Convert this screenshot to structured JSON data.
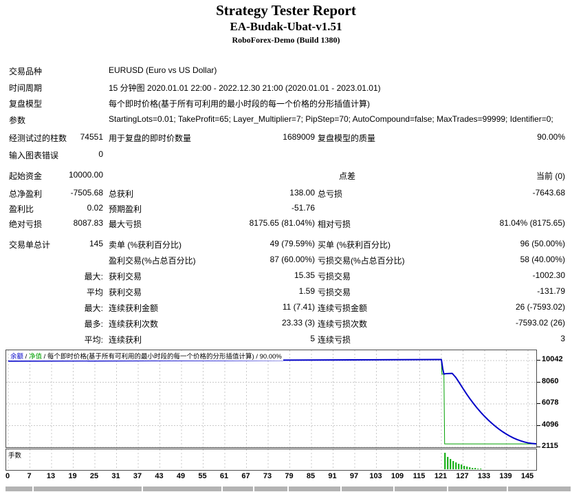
{
  "header": {
    "title": "Strategy Tester Report",
    "ea_name": "EA-Budak-Ubat-v1.51",
    "server": "RoboForex-Demo (Build 1380)"
  },
  "report": {
    "rows": [
      {
        "l1": "交易品种",
        "wide": "EURUSD (Euro vs US Dollar)"
      },
      {
        "l1": "时间周期",
        "wide": "15 分钟图 2020.01.01 22:00 - 2022.12.30 21:00 (2020.01.01 - 2023.01.01)"
      },
      {
        "l1": "复盘模型",
        "wide": "每个即时价格(基于所有可利用的最小时段的每一个价格的分形插值计算)"
      },
      {
        "l1": "参数",
        "wide": "StartingLots=0.01; TakeProfit=65; Layer_Multiplier=7; PipStep=70; AutoCompound=false; MaxTrades=99999; Identifier=0;"
      },
      {
        "l1": "经测试过的柱数",
        "v1": "74551",
        "l2": "用于复盘的即时价数量",
        "v2": "1689009",
        "l3": "复盘模型的质量",
        "v3": "90.00%"
      },
      {
        "l1": "输入图表错误",
        "v1": "0"
      },
      {
        "l1": "起始资金",
        "v1": "10000.00",
        "l3": "点差",
        "v3": "当前 (0)"
      },
      {
        "l1": "总净盈利",
        "v1": "-7505.68",
        "l2": "总获利",
        "v2": "138.00",
        "l3": "总亏损",
        "v3": "-7643.68"
      },
      {
        "l1": "盈利比",
        "v1": "0.02",
        "l2": "预期盈利",
        "v2": "-51.76"
      },
      {
        "l1": "绝对亏损",
        "v1": "8087.83",
        "l2": "最大亏损",
        "v2": "8175.65 (81.04%)",
        "l3": "相对亏损",
        "v3": "81.04% (8175.65)"
      },
      {
        "l1": "交易单总计",
        "v1": "145",
        "l2": "卖单 (%获利百分比)",
        "v2": "49 (79.59%)",
        "l3": "买单 (%获利百分比)",
        "v3": "96 (50.00%)"
      },
      {
        "l2": "盈利交易(%占总百分比)",
        "v2": "87 (60.00%)",
        "l3": "亏损交易(%占总百分比)",
        "v3": "58 (40.00%)"
      },
      {
        "v1": "最大:",
        "l2": "获利交易",
        "v2": "15.35",
        "l3": "亏损交易",
        "v3": "-1002.30"
      },
      {
        "v1": "平均",
        "l2": "获利交易",
        "v2": "1.59",
        "l3": "亏损交易",
        "v3": "-131.79"
      },
      {
        "v1": "最大:",
        "l2": "连续获利金额",
        "v2": "11 (7.41)",
        "l3": "连续亏损金额",
        "v3": "26 (-7593.02)"
      },
      {
        "v1": "最多:",
        "l2": "连续获利次数",
        "v2": "23.33 (3)",
        "l3": "连续亏损次数",
        "v3": "-7593.02 (26)"
      },
      {
        "v1": "平均:",
        "l2": "连续获利",
        "v2": "5",
        "l3": "连续亏损",
        "v3": "3"
      }
    ]
  },
  "legend": {
    "balance_label": "余额",
    "sep": " / ",
    "equity_label": "净值",
    "model_text": "每个即时价格(基于所有可利用的最小时段的每一个价格的分形插值计算) / 90.00%"
  },
  "chart_data": {
    "type": "line",
    "y_ticks": [
      10042,
      8060,
      6078,
      4096,
      2115
    ],
    "x_ticks": [
      0,
      7,
      13,
      19,
      25,
      31,
      37,
      43,
      49,
      55,
      61,
      67,
      73,
      79,
      85,
      91,
      97,
      103,
      109,
      115,
      121,
      127,
      133,
      139,
      145
    ],
    "xlabel": "",
    "ylabel": "",
    "grid": true,
    "colors": {
      "balance": "#0000C8",
      "equity": "#00A000",
      "lots_bar": "#00A800",
      "grid": "#c8c8c8"
    },
    "series": [
      {
        "name": "净值",
        "points": [
          [
            0,
            10000
          ],
          [
            60,
            10060
          ],
          [
            121,
            10138
          ],
          [
            121.15,
            8800
          ],
          [
            121.7,
            8800
          ],
          [
            121.9,
            2420
          ],
          [
            148,
            2420
          ]
        ]
      },
      {
        "name": "余额",
        "points": [
          [
            0,
            10000
          ],
          [
            60,
            10060
          ],
          [
            121,
            10138
          ],
          [
            121.4,
            9250
          ],
          [
            121.7,
            8806
          ],
          [
            122.3,
            8850
          ],
          [
            124,
            8870
          ],
          [
            125,
            8500
          ],
          [
            126,
            8000
          ],
          [
            127,
            7480
          ],
          [
            128,
            6980
          ],
          [
            129,
            6510
          ],
          [
            130,
            6070
          ],
          [
            131,
            5660
          ],
          [
            132,
            5280
          ],
          [
            133,
            4930
          ],
          [
            134,
            4600
          ],
          [
            135,
            4300
          ],
          [
            136,
            4020
          ],
          [
            137,
            3760
          ],
          [
            138,
            3530
          ],
          [
            139,
            3320
          ],
          [
            140,
            3130
          ],
          [
            141,
            2960
          ],
          [
            142,
            2820
          ],
          [
            143,
            2700
          ],
          [
            144,
            2600
          ],
          [
            145,
            2520
          ],
          [
            146,
            2470
          ],
          [
            147,
            2440
          ],
          [
            148,
            2430
          ]
        ]
      }
    ],
    "lots": {
      "label": "手数",
      "start_trade": 122,
      "bar_heights_frac": [
        0.92,
        0.7,
        0.57,
        0.47,
        0.38,
        0.31,
        0.25,
        0.2,
        0.15,
        0.11,
        0.08,
        0.06,
        0.04,
        0.03
      ]
    }
  },
  "bottom_bar": {
    "segments": [
      [
        8,
        39
      ],
      [
        49,
        157
      ],
      [
        208,
        114
      ],
      [
        324,
        44
      ],
      [
        370,
        48
      ],
      [
        420,
        75
      ],
      [
        497,
        75
      ],
      [
        574,
        76
      ],
      [
        652,
        85
      ],
      [
        739,
        91
      ]
    ]
  }
}
